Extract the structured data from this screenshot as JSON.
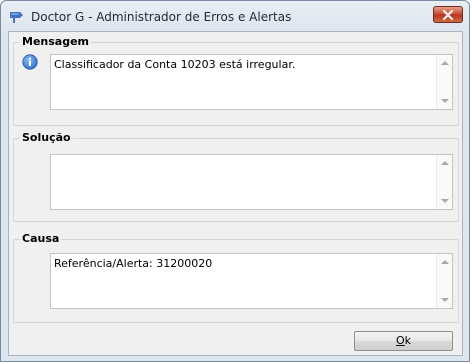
{
  "window": {
    "title": "Doctor G - Administrador de Erros e Alertas",
    "icons": {
      "app": "app-logo-icon",
      "close": "close-icon"
    }
  },
  "mensagem": {
    "label": "Mensagem",
    "icon": "info-icon",
    "text": "Classificador da Conta 10203 está irregular."
  },
  "solucao": {
    "label": "Solução",
    "text": ""
  },
  "causa": {
    "label": "Causa",
    "text": "Referência/Alerta: 31200020"
  },
  "buttons": {
    "ok_mnemonic": "O",
    "ok_rest": "k"
  },
  "colors": {
    "accent": "#2a6fc9",
    "close": "#c8452e"
  }
}
